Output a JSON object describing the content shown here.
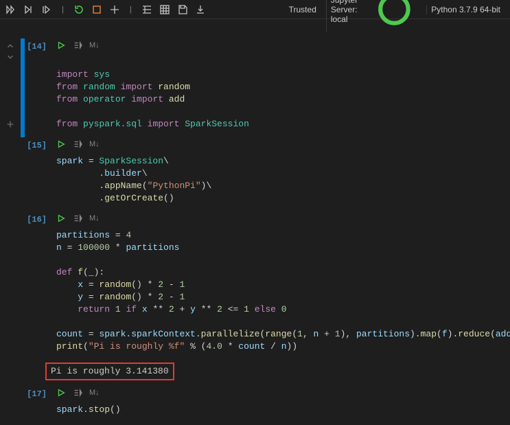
{
  "toolbar": {
    "status": {
      "trusted": "Trusted",
      "server": "Jupyter Server: local",
      "kernel": "Python 3.7.9 64-bit"
    }
  },
  "cell_action_markdown": "M↓",
  "cells": [
    {
      "exec": "[14]",
      "code": [
        {
          "t": ""
        },
        {
          "t": "import ",
          "c": "kw",
          "rest": [
            {
              "t": "sys",
              "c": "mod"
            }
          ]
        },
        {
          "t": "from ",
          "c": "kw",
          "rest": [
            {
              "t": "random ",
              "c": "mod"
            },
            {
              "t": "import ",
              "c": "kw"
            },
            {
              "t": "random",
              "c": "fn"
            }
          ]
        },
        {
          "t": "from ",
          "c": "kw",
          "rest": [
            {
              "t": "operator ",
              "c": "mod"
            },
            {
              "t": "import ",
              "c": "kw"
            },
            {
              "t": "add",
              "c": "fn"
            }
          ]
        },
        {
          "t": ""
        },
        {
          "t": "from ",
          "c": "kw",
          "rest": [
            {
              "t": "pyspark.sql ",
              "c": "mod"
            },
            {
              "t": "import ",
              "c": "kw"
            },
            {
              "t": "SparkSession",
              "c": "mod"
            }
          ]
        }
      ]
    },
    {
      "exec": "[15]",
      "code": [
        {
          "t": "spark ",
          "c": "var",
          "rest": [
            {
              "t": "= ",
              "c": "op"
            },
            {
              "t": "SparkSession",
              "c": "mod"
            },
            {
              "t": "\\",
              "c": "op"
            }
          ]
        },
        {
          "t": "        .builder",
          "c": "var",
          "rest": [
            {
              "t": "\\",
              "c": "op"
            }
          ]
        },
        {
          "t": "        .",
          "c": "op",
          "rest": [
            {
              "t": "appName",
              "c": "fn"
            },
            {
              "t": "(",
              "c": "op"
            },
            {
              "t": "\"PythonPi\"",
              "c": "str"
            },
            {
              "t": ")",
              "c": "op"
            },
            {
              "t": "\\",
              "c": "op"
            }
          ]
        },
        {
          "t": "        .",
          "c": "op",
          "rest": [
            {
              "t": "getOrCreate",
              "c": "fn"
            },
            {
              "t": "()",
              "c": "op"
            }
          ]
        }
      ]
    },
    {
      "exec": "[16]",
      "code": [
        {
          "t": "partitions ",
          "c": "var",
          "rest": [
            {
              "t": "= ",
              "c": "op"
            },
            {
              "t": "4",
              "c": "num"
            }
          ]
        },
        {
          "t": "n ",
          "c": "var",
          "rest": [
            {
              "t": "= ",
              "c": "op"
            },
            {
              "t": "100000",
              "c": "num"
            },
            {
              "t": " * ",
              "c": "op"
            },
            {
              "t": "partitions",
              "c": "var"
            }
          ]
        },
        {
          "t": ""
        },
        {
          "t": "def ",
          "c": "kw",
          "rest": [
            {
              "t": "f",
              "c": "fn"
            },
            {
              "t": "(_):",
              "c": "op"
            }
          ]
        },
        {
          "t": "    x ",
          "c": "var",
          "rest": [
            {
              "t": "= ",
              "c": "op"
            },
            {
              "t": "random",
              "c": "fn"
            },
            {
              "t": "() * ",
              "c": "op"
            },
            {
              "t": "2",
              "c": "num"
            },
            {
              "t": " - ",
              "c": "op"
            },
            {
              "t": "1",
              "c": "num"
            }
          ]
        },
        {
          "t": "    y ",
          "c": "var",
          "rest": [
            {
              "t": "= ",
              "c": "op"
            },
            {
              "t": "random",
              "c": "fn"
            },
            {
              "t": "() * ",
              "c": "op"
            },
            {
              "t": "2",
              "c": "num"
            },
            {
              "t": " - ",
              "c": "op"
            },
            {
              "t": "1",
              "c": "num"
            }
          ]
        },
        {
          "t": "    return ",
          "c": "kw",
          "rest": [
            {
              "t": "1",
              "c": "num"
            },
            {
              "t": " if ",
              "c": "kw"
            },
            {
              "t": "x ",
              "c": "var"
            },
            {
              "t": "** ",
              "c": "op"
            },
            {
              "t": "2",
              "c": "num"
            },
            {
              "t": " + ",
              "c": "op"
            },
            {
              "t": "y ",
              "c": "var"
            },
            {
              "t": "** ",
              "c": "op"
            },
            {
              "t": "2",
              "c": "num"
            },
            {
              "t": " <= ",
              "c": "op"
            },
            {
              "t": "1",
              "c": "num"
            },
            {
              "t": " else ",
              "c": "kw"
            },
            {
              "t": "0",
              "c": "num"
            }
          ]
        },
        {
          "t": ""
        },
        {
          "t": "count ",
          "c": "var",
          "rest": [
            {
              "t": "= ",
              "c": "op"
            },
            {
              "t": "spark.sparkContext.",
              "c": "var"
            },
            {
              "t": "parallelize",
              "c": "fn"
            },
            {
              "t": "(",
              "c": "op"
            },
            {
              "t": "range",
              "c": "fn"
            },
            {
              "t": "(",
              "c": "op"
            },
            {
              "t": "1",
              "c": "num"
            },
            {
              "t": ", ",
              "c": "op"
            },
            {
              "t": "n ",
              "c": "var"
            },
            {
              "t": "+ ",
              "c": "op"
            },
            {
              "t": "1",
              "c": "num"
            },
            {
              "t": "), ",
              "c": "op"
            },
            {
              "t": "partitions",
              "c": "var"
            },
            {
              "t": ").",
              "c": "op"
            },
            {
              "t": "map",
              "c": "fn"
            },
            {
              "t": "(",
              "c": "op"
            },
            {
              "t": "f",
              "c": "var"
            },
            {
              "t": ").",
              "c": "op"
            },
            {
              "t": "reduce",
              "c": "fn"
            },
            {
              "t": "(",
              "c": "op"
            },
            {
              "t": "add",
              "c": "var"
            },
            {
              "t": ")",
              "c": "op"
            }
          ]
        },
        {
          "t": "print",
          "c": "fn",
          "rest": [
            {
              "t": "(",
              "c": "op"
            },
            {
              "t": "\"Pi is roughly %f\"",
              "c": "str"
            },
            {
              "t": " % (",
              "c": "op"
            },
            {
              "t": "4.0",
              "c": "num"
            },
            {
              "t": " * ",
              "c": "op"
            },
            {
              "t": "count ",
              "c": "var"
            },
            {
              "t": "/ ",
              "c": "op"
            },
            {
              "t": "n",
              "c": "var"
            },
            {
              "t": "))",
              "c": "op"
            }
          ]
        }
      ],
      "output": "Pi is roughly 3.141380"
    },
    {
      "exec": "[17]",
      "code": [
        {
          "t": "spark.",
          "c": "var",
          "rest": [
            {
              "t": "stop",
              "c": "fn"
            },
            {
              "t": "()",
              "c": "op"
            }
          ]
        }
      ]
    }
  ]
}
